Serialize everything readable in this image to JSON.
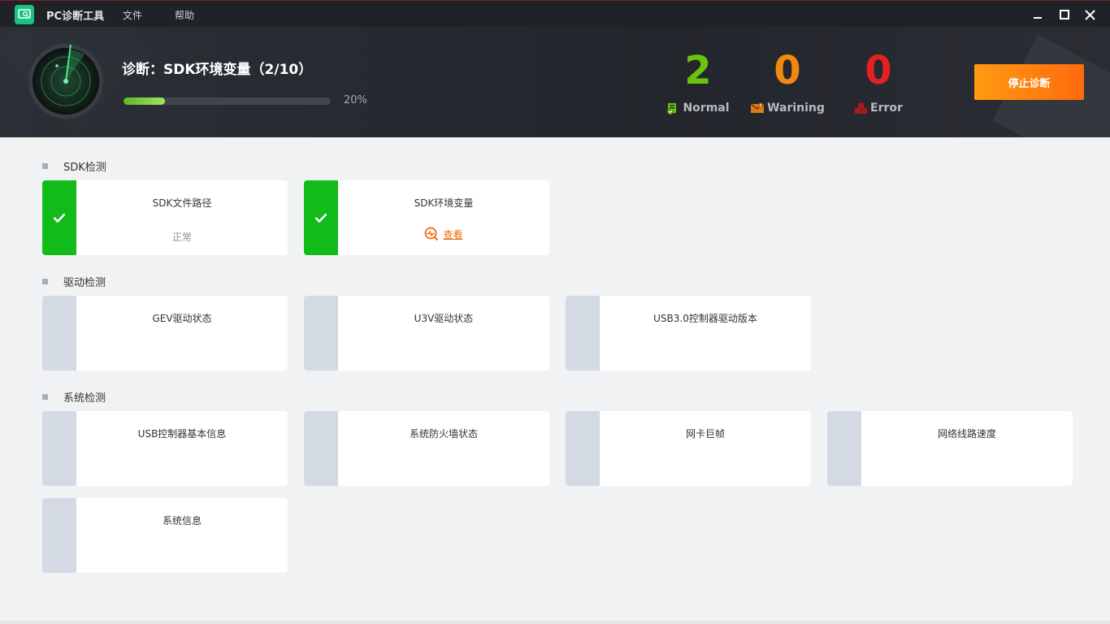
{
  "app": {
    "title": "PC诊断工具",
    "menu": [
      "文件",
      "帮助"
    ]
  },
  "header": {
    "diagnosing_title": "诊断：SDK环境变量（2/10）",
    "progress_percent": 20,
    "progress_text": "20%",
    "stats": [
      {
        "count": "2",
        "label": "Normal",
        "color": "#6bc30e"
      },
      {
        "count": "0",
        "label": "Warining",
        "color": "#f0890e"
      },
      {
        "count": "0",
        "label": "Error",
        "color": "#e42020"
      }
    ],
    "stop_button": "停止诊断"
  },
  "sections": [
    {
      "title": "SDK检测",
      "items": [
        {
          "name": "SDK文件路径",
          "state": "ok",
          "status": "正常"
        },
        {
          "name": "SDK环境变量",
          "state": "ok",
          "link": "查看"
        }
      ]
    },
    {
      "title": "驱动检测",
      "items": [
        {
          "name": "GEV驱动状态"
        },
        {
          "name": "U3V驱动状态"
        },
        {
          "name": "USB3.0控制器驱动版本"
        }
      ]
    },
    {
      "title": "系统检测",
      "items": [
        {
          "name": "USB控制器基本信息"
        },
        {
          "name": "系统防火墙状态"
        },
        {
          "name": "网卡巨帧"
        },
        {
          "name": "网络线路速度"
        },
        {
          "name": "系统信息"
        }
      ]
    }
  ],
  "colors": {
    "ok_strip": "#11bb1a",
    "pending_strip": "#d4dae4",
    "accent_orange": "#ff7f0e"
  }
}
